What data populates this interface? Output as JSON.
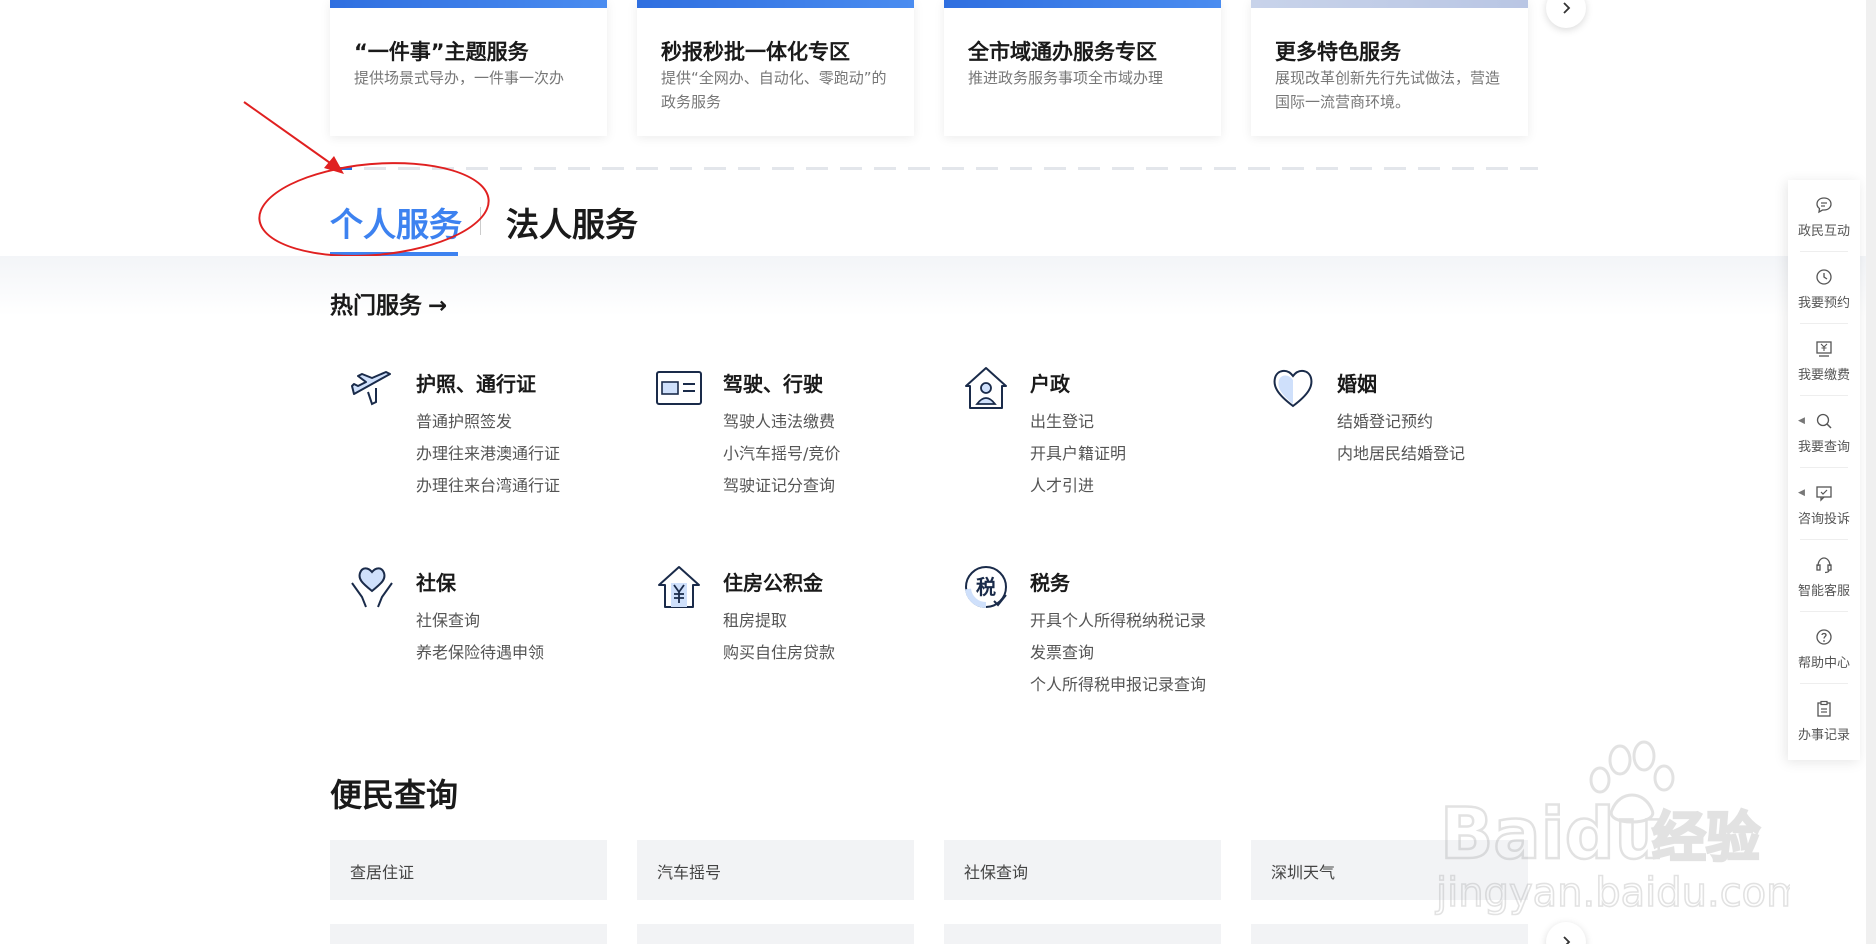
{
  "top_cards": [
    {
      "title": "“一件事”主题服务",
      "desc": "提供场景式导办，一件事一次办"
    },
    {
      "title": "秒报秒批一体化专区",
      "desc": "提供“全网办、自动化、零跑动”的政务服务"
    },
    {
      "title": "全市域通办服务专区",
      "desc": "推进政务服务事项全市域办理"
    },
    {
      "title": "更多特色服务",
      "desc": "展现改革创新先行先试做法，营造国际一流营商环境。"
    }
  ],
  "tabs": {
    "personal": "个人服务",
    "legal": "法人服务"
  },
  "hot": {
    "heading": "热门服务",
    "arrow": "→",
    "groups": [
      {
        "icon": "airplane-icon",
        "title": "护照、通行证",
        "links": [
          "普通护照签发",
          "办理往来港澳通行证",
          "办理往来台湾通行证"
        ]
      },
      {
        "icon": "license-card-icon",
        "title": "驾驶、行驶",
        "links": [
          "驾驶人违法缴费",
          "小汽车摇号/竞价",
          "驾驶证记分查询"
        ]
      },
      {
        "icon": "house-person-icon",
        "title": "户政",
        "links": [
          "出生登记",
          "开具户籍证明",
          "人才引进"
        ]
      },
      {
        "icon": "heart-icon",
        "title": "婚姻",
        "links": [
          "结婚登记预约",
          "内地居民结婚登记"
        ]
      },
      {
        "icon": "heart-hands-icon",
        "title": "社保",
        "links": [
          "社保查询",
          "养老保险待遇申领"
        ]
      },
      {
        "icon": "house-yuan-icon",
        "title": "住房公积金",
        "links": [
          "租房提取",
          "购买自住房贷款"
        ]
      },
      {
        "icon": "tax-icon",
        "title": "税务",
        "links": [
          "开具个人所得税纳税记录",
          "发票查询",
          "个人所得税申报记录查询"
        ],
        "icon_text": "税"
      }
    ]
  },
  "query": {
    "title": "便民查询",
    "items": [
      "查居住证",
      "汽车摇号",
      "社保查询",
      "深圳天气"
    ]
  },
  "toolbar": [
    {
      "label": "政民互动",
      "icon": "chat-bubble-icon",
      "caret": false
    },
    {
      "label": "我要预约",
      "icon": "clock-icon",
      "caret": false
    },
    {
      "label": "我要缴费",
      "icon": "payment-icon",
      "caret": false
    },
    {
      "label": "我要查询",
      "icon": "search-icon",
      "caret": true
    },
    {
      "label": "咨询投诉",
      "icon": "message-icon",
      "caret": true
    },
    {
      "label": "智能客服",
      "icon": "headset-icon",
      "caret": false
    },
    {
      "label": "帮助中心",
      "icon": "help-icon",
      "caret": false
    },
    {
      "label": "办事记录",
      "icon": "clipboard-icon",
      "caret": false
    }
  ],
  "colors": {
    "accent": "#3d82f0",
    "annotation": "#e02020"
  },
  "watermark": {
    "brand": "Baidu",
    "cn": "经验",
    "url": "jingyan.baidu.com"
  }
}
